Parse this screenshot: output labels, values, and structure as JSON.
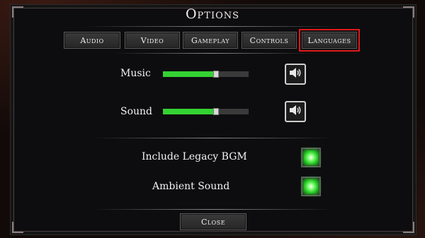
{
  "title": "Options",
  "tabs": [
    {
      "label": "Audio"
    },
    {
      "label": "Video"
    },
    {
      "label": "Gameplay"
    },
    {
      "label": "Controls"
    },
    {
      "label": "Languages"
    }
  ],
  "selected_tab": "Languages",
  "audio": {
    "music": {
      "label": "Music",
      "level": 0.62
    },
    "sound": {
      "label": "Sound",
      "level": 0.62
    }
  },
  "toggles": [
    {
      "label": "Include Legacy BGM",
      "on": true
    },
    {
      "label": "Ambient Sound",
      "on": true
    }
  ],
  "close_label": "Close",
  "colors": {
    "slider_fill": "#34d233",
    "highlight": "#e01818",
    "toggle_on": "#2dff2d"
  },
  "icons": {
    "speaker": "speaker-icon"
  }
}
